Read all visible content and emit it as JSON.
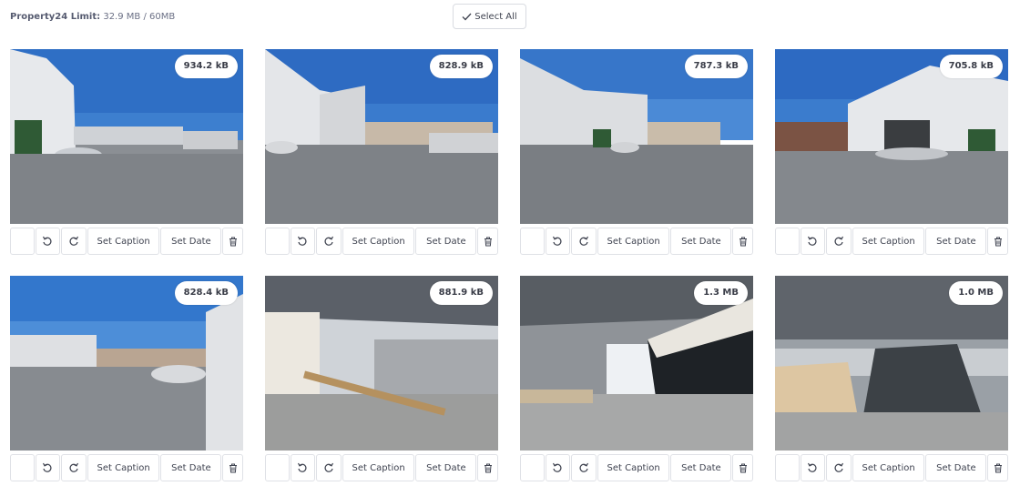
{
  "header": {
    "limit_label": "Property24 Limit:",
    "limit_value": "32.9 MB / 60MB",
    "select_all_label": "Select All"
  },
  "photos": [
    {
      "size": "934.2 kB",
      "scene": "exterior-left"
    },
    {
      "size": "828.9 kB",
      "scene": "exterior-center"
    },
    {
      "size": "787.3 kB",
      "scene": "exterior-center-2"
    },
    {
      "size": "705.8 kB",
      "scene": "exterior-front"
    },
    {
      "size": "828.4 kB",
      "scene": "exterior-side"
    },
    {
      "size": "881.9 kB",
      "scene": "interior-1"
    },
    {
      "size": "1.3 MB",
      "scene": "interior-2"
    },
    {
      "size": "1.0 MB",
      "scene": "interior-3"
    }
  ],
  "actions": {
    "caption_label": "Set Caption",
    "date_label": "Set Date"
  },
  "icons": {
    "check": "check-icon",
    "rotate_left": "rotate-left-icon",
    "rotate_right": "rotate-right-icon",
    "trash": "trash-icon"
  }
}
